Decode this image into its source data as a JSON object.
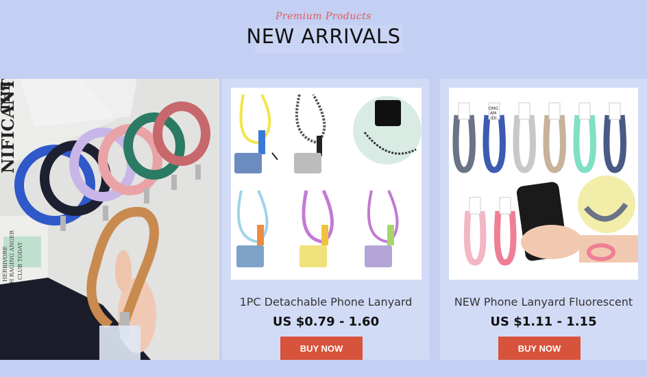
{
  "header": {
    "subtitle": "Premium Products",
    "title": "NEW ARRIVALS"
  },
  "hero": {
    "newspaper_text": [
      "NIFICANT",
      "THE",
      "HERBIVORE",
      "TH RAGING ANGER",
      "THE CLUB TODAY"
    ],
    "colors": [
      "#2f58c9",
      "#1c2030",
      "#c8b6e8",
      "#e9a3a7",
      "#2b7a63",
      "#c7686c",
      "#c98a4f"
    ]
  },
  "products": [
    {
      "name": "1PC Detachable Phone Lanyard",
      "price": "US $0.79 - 1.60",
      "button": "BUY NOW",
      "image": "detachable-lanyard-image"
    },
    {
      "name": "NEW Phone Lanyard Fluorescent",
      "price": "US $1.11 - 1.15",
      "button": "BUY NOW",
      "image": "fluorescent-lanyard-image",
      "strap_label": [
        "ONG",
        "AM",
        "IDI"
      ]
    }
  ],
  "colors": {
    "background": "#c3cff3",
    "button": "#d8533c",
    "subtitle": "#e05a55"
  }
}
